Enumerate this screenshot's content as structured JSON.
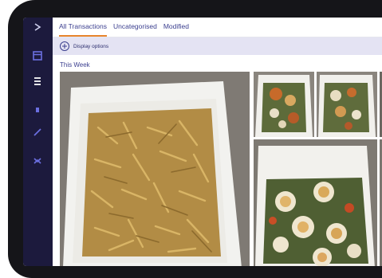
{
  "tabs": [
    {
      "label": "All Transactions",
      "active": true
    },
    {
      "label": "Uncategorised",
      "active": false
    },
    {
      "label": "Modified",
      "active": false
    }
  ],
  "toolbar": {
    "display_options_label": "Display options",
    "icon": "plus-circle-icon"
  },
  "section": {
    "title": "This Week"
  },
  "sidebar": {
    "icons": [
      "collapse-icon",
      "calendar-icon",
      "list-icon",
      "tag-icon",
      "pen-icon",
      "link-icon"
    ]
  },
  "colors": {
    "sidebar": "#1c1a3d",
    "accent": "#3b3f8f",
    "tab_underline": "#e8842c",
    "toolbar_bg": "#e4e3f3"
  }
}
